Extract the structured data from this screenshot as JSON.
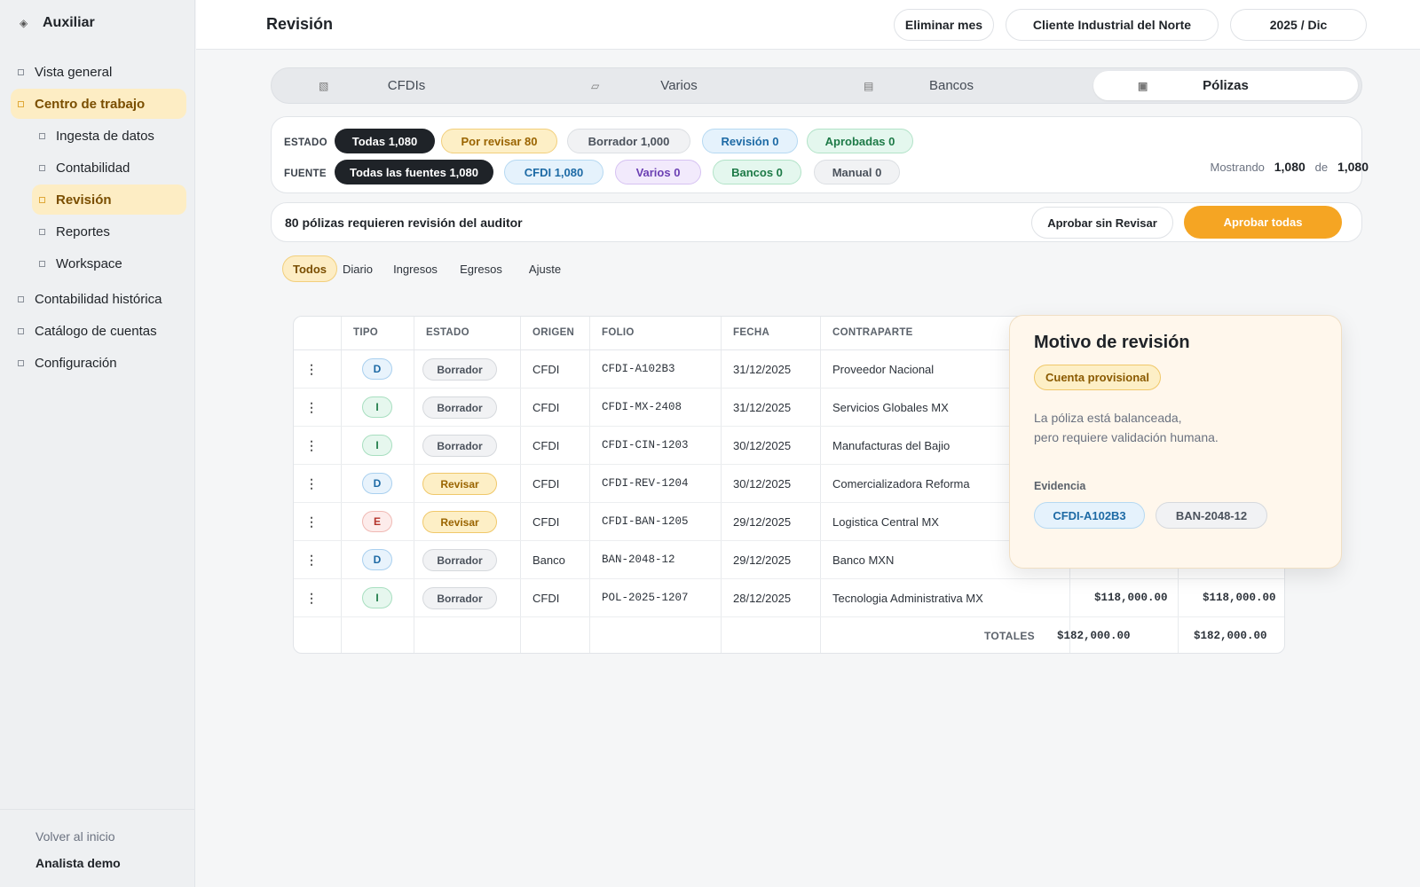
{
  "sidebar": {
    "brand": "Auxiliar",
    "brand_icon": "diamond-icon",
    "items": [
      {
        "label": "Vista general"
      },
      {
        "label": "Centro de trabajo"
      },
      {
        "label": "Ingesta de datos"
      },
      {
        "label": "Contabilidad"
      },
      {
        "label": "Revisión"
      },
      {
        "label": "Reportes"
      },
      {
        "label": "Workspace"
      },
      {
        "label": "Contabilidad histórica"
      },
      {
        "label": "Catálogo de cuentas"
      },
      {
        "label": "Configuración"
      }
    ],
    "back_label": "Volver al inicio",
    "user": "Analista demo"
  },
  "header": {
    "title": "Revisión",
    "delete_month": "Eliminar mes",
    "client": "Cliente Industrial del Norte",
    "period": "2025 / Dic"
  },
  "tabs": [
    {
      "label": "CFDIs",
      "icon": "document-icon"
    },
    {
      "label": "Varios",
      "icon": "folder-icon"
    },
    {
      "label": "Bancos",
      "icon": "bank-icon"
    },
    {
      "label": "Pólizas",
      "icon": "ledger-icon"
    }
  ],
  "filters": {
    "estado_label": "ESTADO",
    "estado": [
      "Todas 1,080",
      "Por revisar 80",
      "Borrador 1,000",
      "Revisión 0",
      "Aprobadas 0"
    ],
    "fuente_label": "FUENTE",
    "fuente": [
      "Todas las fuentes 1,080",
      "CFDI 1,080",
      "Varios 0",
      "Bancos 0",
      "Manual 0"
    ],
    "showing_prefix": "Mostrando",
    "showing_count": "1,080",
    "showing_of": "de",
    "showing_total": "1,080"
  },
  "banner": {
    "text": "80 pólizas requieren revisión del auditor",
    "approve_no_review": "Aprobar sin Revisar",
    "approve_all": "Aprobar todas"
  },
  "subfilters": [
    "Todos",
    "Diario",
    "Ingresos",
    "Egresos",
    "Ajuste"
  ],
  "table": {
    "headers": [
      "TIPO",
      "ESTADO",
      "ORIGEN",
      "FOLIO",
      "FECHA",
      "CONTRAPARTE"
    ],
    "rows": [
      {
        "tipo": "D",
        "estado": "Borrador",
        "origen": "CFDI",
        "folio": "CFDI-A102B3",
        "fecha": "31/12/2025",
        "contraparte": "Proveedor Nacional",
        "debe": "",
        "haber": ""
      },
      {
        "tipo": "I",
        "estado": "Borrador",
        "origen": "CFDI",
        "folio": "CFDI-MX-2408",
        "fecha": "31/12/2025",
        "contraparte": "Servicios Globales MX",
        "debe": "",
        "haber": ""
      },
      {
        "tipo": "I",
        "estado": "Borrador",
        "origen": "CFDI",
        "folio": "CFDI-CIN-1203",
        "fecha": "30/12/2025",
        "contraparte": "Manufacturas del Bajio",
        "debe": "",
        "haber": ""
      },
      {
        "tipo": "D",
        "estado": "Revisar",
        "origen": "CFDI",
        "folio": "CFDI-REV-1204",
        "fecha": "30/12/2025",
        "contraparte": "Comercializadora Reforma",
        "debe": "",
        "haber": ""
      },
      {
        "tipo": "E",
        "estado": "Revisar",
        "origen": "CFDI",
        "folio": "CFDI-BAN-1205",
        "fecha": "29/12/2025",
        "contraparte": "Logistica Central MX",
        "debe": "",
        "haber": ""
      },
      {
        "tipo": "D",
        "estado": "Borrador",
        "origen": "Banco",
        "folio": "BAN-2048-12",
        "fecha": "29/12/2025",
        "contraparte": "Banco MXN",
        "debe": "",
        "haber": ""
      },
      {
        "tipo": "I",
        "estado": "Borrador",
        "origen": "CFDI",
        "folio": "POL-2025-1207",
        "fecha": "28/12/2025",
        "contraparte": "Tecnologia Administrativa MX",
        "debe": "$118,000.00",
        "haber": "$118,000.00"
      }
    ],
    "totals_label": "TOTALES",
    "total_debe": "$182,000.00",
    "total_haber": "$182,000.00"
  },
  "popover": {
    "title": "Motivo de revisión",
    "badge": "Cuenta provisional",
    "line1": "La póliza está balanceada,",
    "line2": "pero requiere validación humana.",
    "evidence_label": "Evidencia",
    "evidence": [
      "CFDI-A102B3",
      "BAN-2048-12"
    ]
  },
  "colors": {
    "accent": "#f5a523",
    "active_nav_bg": "#fdedc4",
    "popover_bg": "#fff7ec"
  }
}
